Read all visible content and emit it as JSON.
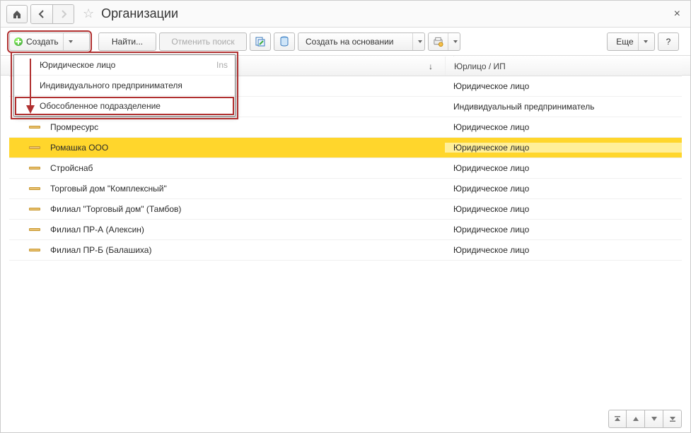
{
  "title": "Организации",
  "toolbar": {
    "create_label": "Создать",
    "find_label": "Найти...",
    "cancel_search_label": "Отменить поиск",
    "create_based_label": "Создать на основании",
    "more_label": "Еще",
    "help_label": "?"
  },
  "create_menu": {
    "items": [
      {
        "label": "Юридическое лицо",
        "shortcut": "Ins"
      },
      {
        "label": "Индивидуального предпринимателя",
        "shortcut": ""
      },
      {
        "label": "Обособленное подразделение",
        "shortcut": ""
      }
    ]
  },
  "columns": {
    "name": "",
    "sort_indicator": "↓",
    "type": "Юрлицо / ИП"
  },
  "rows": [
    {
      "name": "",
      "type": "Юридическое лицо",
      "hidden": true
    },
    {
      "name": "",
      "type": "Индивидуальный предприниматель",
      "hidden": true
    },
    {
      "name": "Промресурс",
      "type": "Юридическое лицо",
      "selected": false
    },
    {
      "name": "Ромашка ООО",
      "type": "Юридическое лицо",
      "selected": true
    },
    {
      "name": "Стройснаб",
      "type": "Юридическое лицо",
      "selected": false
    },
    {
      "name": "Торговый дом \"Комплексный\"",
      "type": "Юридическое лицо",
      "selected": false
    },
    {
      "name": "Филиал \"Торговый дом\" (Тамбов)",
      "type": "Юридическое лицо",
      "selected": false
    },
    {
      "name": "Филиал ПР-А (Алексин)",
      "type": "Юридическое лицо",
      "selected": false
    },
    {
      "name": "Филиал ПР-Б (Балашиха)",
      "type": "Юридическое лицо",
      "selected": false
    }
  ]
}
